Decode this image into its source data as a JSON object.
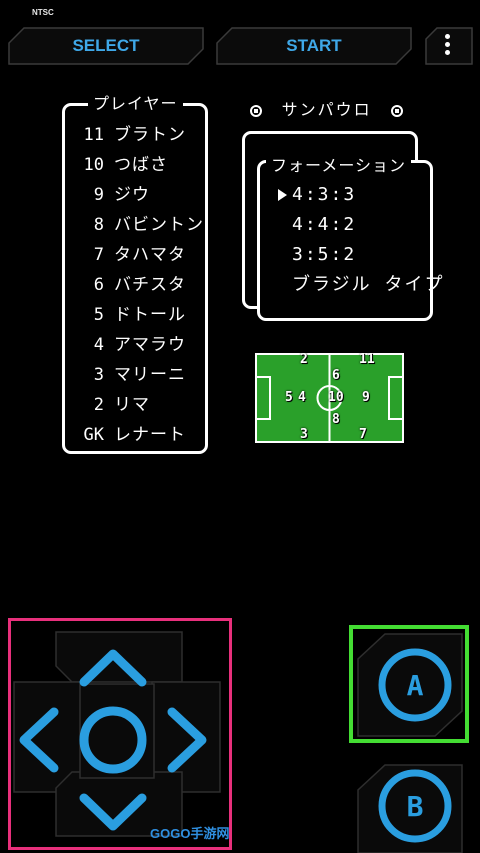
{
  "header": {
    "video_mode": "NTSC",
    "select_label": "SELECT",
    "start_label": "START",
    "menu_icon": "more-vertical-icon"
  },
  "players_panel": {
    "title": "プレイヤー",
    "players": [
      {
        "number": "11",
        "name": "ブラトン"
      },
      {
        "number": "10",
        "name": "つばさ"
      },
      {
        "number": "9",
        "name": "ジウ"
      },
      {
        "number": "8",
        "name": "バビントン"
      },
      {
        "number": "7",
        "name": "タハマタ"
      },
      {
        "number": "6",
        "name": "バチスタ"
      },
      {
        "number": "5",
        "name": "ドトール"
      },
      {
        "number": "4",
        "name": "アマラウ"
      },
      {
        "number": "3",
        "name": "マリーニ"
      },
      {
        "number": "2",
        "name": "リマ"
      },
      {
        "number": "GK",
        "name": "レナート"
      }
    ]
  },
  "team": {
    "name": "サンパウロ"
  },
  "formation_panel": {
    "title": "フォーメーション",
    "options": [
      "4:3:3",
      "4:4:2",
      "3:5:2",
      "ブラジル タイプ"
    ],
    "selected_index": 0
  },
  "field_map": {
    "positions": [
      "2",
      "11",
      "6",
      "5",
      "4",
      "10",
      "9",
      "8",
      "3",
      "7"
    ]
  },
  "controls": {
    "a_label": "A",
    "b_label": "B"
  },
  "watermark": "GOGO手游网",
  "colors": {
    "accent_blue": "#3fa8e8",
    "dpad_highlight": "#e8307c",
    "a_highlight": "#44dd33",
    "pitch_green": "#2aa02a"
  }
}
